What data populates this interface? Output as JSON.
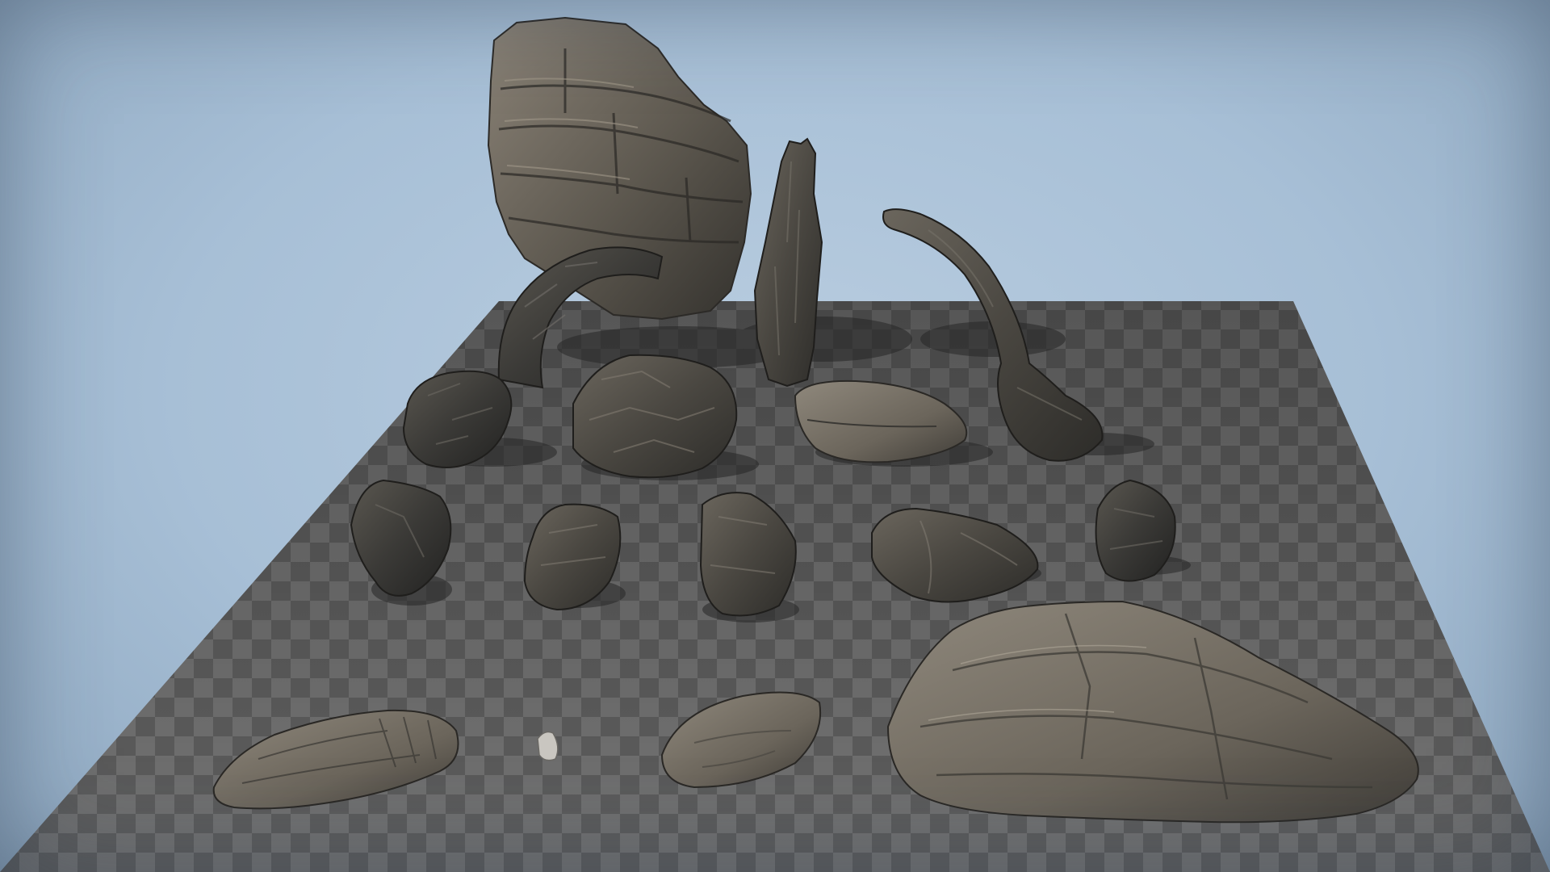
{
  "scene": {
    "background_color": "#a9c1d8",
    "floor_checker_light": "#737373",
    "floor_checker_dark": "#5e5e5e",
    "rock_base": "#4d4a45",
    "rock_light": "#8a8275",
    "rock_dark": "#2b2a28",
    "shadow_color": "#262626"
  },
  "objects": [
    {
      "name": "large-cliff-rock",
      "kind": "cliff"
    },
    {
      "name": "rock-arch",
      "kind": "arch"
    },
    {
      "name": "tall-spire-rock",
      "kind": "spire"
    },
    {
      "name": "curved-rock-arm",
      "kind": "arm"
    },
    {
      "name": "rock-cluster-small",
      "kind": "cluster"
    },
    {
      "name": "rock-cluster-large",
      "kind": "cluster"
    },
    {
      "name": "flat-boulder",
      "kind": "boulder"
    },
    {
      "name": "rock-pair-left",
      "kind": "rock"
    },
    {
      "name": "rock-slab-left",
      "kind": "rock"
    },
    {
      "name": "rock-block-center",
      "kind": "rock"
    },
    {
      "name": "rock-stack-right",
      "kind": "rock"
    },
    {
      "name": "rock-chunk-right",
      "kind": "rock"
    },
    {
      "name": "flat-rock-slab",
      "kind": "slab"
    },
    {
      "name": "tiny-pebble",
      "kind": "pebble"
    },
    {
      "name": "smooth-stone",
      "kind": "stone"
    },
    {
      "name": "large-flat-rock",
      "kind": "slab"
    }
  ]
}
